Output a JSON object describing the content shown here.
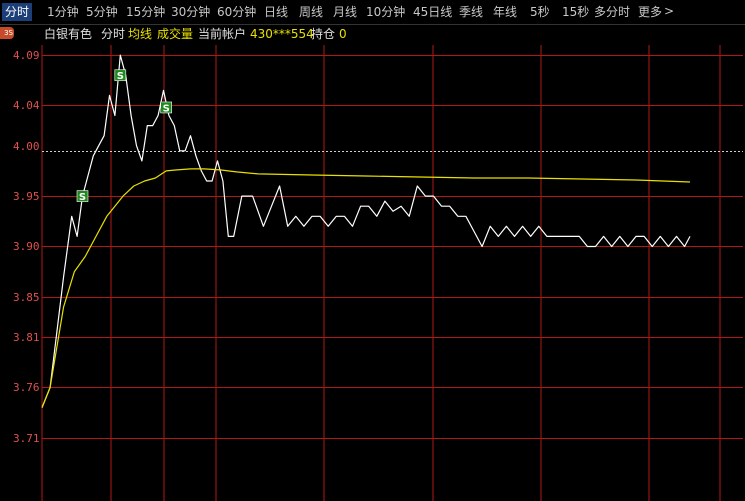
{
  "tabs": [
    "分时",
    "1分钟",
    "5分钟",
    "15分钟",
    "30分钟",
    "60分钟",
    "日线",
    "周线",
    "月线",
    "10分钟",
    "45日线",
    "季线",
    "年线",
    "5秒",
    "15秒",
    "多分时",
    "更多"
  ],
  "active_tab": "分时",
  "more_arrow": ">",
  "badge": "3S",
  "info": {
    "stock_name": "白银有色",
    "mode": "分时",
    "avg_line": "均线",
    "volume": "成交量",
    "account_label": "当前帐户",
    "account_value": "430***554",
    "position_label": "持仓",
    "position_value": "0"
  },
  "colors": {
    "background": "#000000",
    "grid": "#b01818",
    "price_line": "#ffffff",
    "avg_line": "#e8e000",
    "axis_label": "#e05050",
    "sell_marker": "#1e8a1e",
    "active_tab_bg": "#1c3f7a"
  },
  "chart_data": {
    "type": "line",
    "y_ticks": [
      "4.09",
      "4.04",
      "4.00",
      "3.95",
      "3.90",
      "3.85",
      "3.81",
      "3.76",
      "3.71"
    ],
    "ylim": [
      3.687,
      4.104
    ],
    "x_range": [
      0,
      240
    ],
    "reference_price": 3.995,
    "series": [
      {
        "x": [
          0,
          3,
          8,
          11,
          13,
          15,
          17,
          19,
          21,
          23,
          25,
          27,
          29,
          31,
          33,
          35,
          37,
          39,
          41,
          43,
          45,
          47,
          49,
          51,
          53,
          55,
          57,
          59,
          61,
          63,
          65,
          67,
          69,
          71,
          74,
          78,
          82,
          85,
          88,
          91,
          94,
          97,
          100,
          103,
          106,
          109,
          112,
          115,
          118,
          121,
          124,
          127,
          130,
          133,
          136,
          139,
          142,
          145,
          148,
          151,
          154,
          157,
          160,
          163,
          166,
          169,
          172,
          175,
          178,
          181,
          184,
          187,
          190,
          193,
          196,
          199,
          202,
          205,
          208,
          211,
          214,
          217,
          220,
          223,
          226,
          229,
          232,
          235,
          238,
          240
        ],
        "values": [
          3.74,
          3.76,
          3.87,
          3.93,
          3.91,
          3.95,
          3.97,
          3.99,
          4.0,
          4.01,
          4.05,
          4.03,
          4.09,
          4.07,
          4.03,
          4.0,
          3.985,
          4.02,
          4.02,
          4.03,
          4.055,
          4.03,
          4.02,
          3.995,
          3.995,
          4.01,
          3.99,
          3.975,
          3.965,
          3.965,
          3.985,
          3.965,
          3.91,
          3.91,
          3.95,
          3.95,
          3.92,
          3.94,
          3.96,
          3.92,
          3.93,
          3.92,
          3.93,
          3.93,
          3.92,
          3.93,
          3.93,
          3.92,
          3.94,
          3.94,
          3.93,
          3.945,
          3.935,
          3.94,
          3.93,
          3.96,
          3.95,
          3.95,
          3.94,
          3.94,
          3.93,
          3.93,
          3.915,
          3.9,
          3.92,
          3.91,
          3.92,
          3.91,
          3.92,
          3.91,
          3.92,
          3.91,
          3.91,
          3.91,
          3.91,
          3.91,
          3.9,
          3.9,
          3.91,
          3.9,
          3.91,
          3.9,
          3.91,
          3.91,
          3.9,
          3.91,
          3.9,
          3.91,
          3.9,
          3.91
        ]
      },
      {
        "x": [
          0,
          3,
          8,
          12,
          16,
          20,
          24,
          27,
          30,
          34,
          38,
          42,
          46,
          50,
          55,
          60,
          66,
          72,
          80,
          100,
          120,
          140,
          160,
          180,
          200,
          220,
          240
        ],
        "values": [
          3.74,
          3.76,
          3.84,
          3.875,
          3.89,
          3.91,
          3.93,
          3.94,
          3.95,
          3.96,
          3.965,
          3.968,
          3.975,
          3.976,
          3.977,
          3.977,
          3.976,
          3.974,
          3.972,
          3.971,
          3.97,
          3.969,
          3.968,
          3.968,
          3.967,
          3.966,
          3.964
        ]
      }
    ],
    "sell_markers": [
      {
        "x": 15,
        "y": 3.95,
        "label": "S"
      },
      {
        "x": 29,
        "y": 4.07,
        "label": "S"
      },
      {
        "x": 46,
        "y": 4.038,
        "label": "S"
      }
    ]
  }
}
